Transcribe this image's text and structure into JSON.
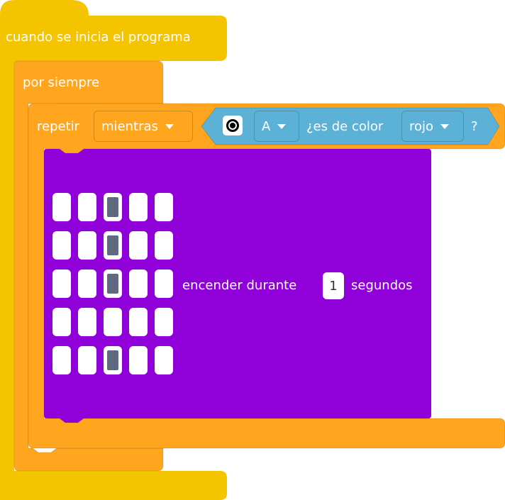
{
  "event_block": {
    "label": "cuando se inicia el programa"
  },
  "forever_block": {
    "label": "por siempre"
  },
  "repeat_block": {
    "label": "repetir",
    "mode_dropdown": "mientras"
  },
  "condition_block": {
    "port_icon": "color-sensor-icon",
    "port_dropdown": "A",
    "question": "¿es de color",
    "color_dropdown": "rojo",
    "question_end": "?"
  },
  "light_block": {
    "text_before": "encender durante",
    "duration": "1",
    "text_after": "segundos",
    "matrix": [
      [
        0,
        0,
        1,
        0,
        0
      ],
      [
        0,
        0,
        1,
        0,
        0
      ],
      [
        0,
        0,
        1,
        0,
        0
      ],
      [
        0,
        0,
        0,
        0,
        0
      ],
      [
        0,
        0,
        1,
        0,
        0
      ]
    ]
  },
  "colors": {
    "event": "#f5c400",
    "control": "#ffa51e",
    "sensor": "#5cb1d6",
    "light": "#9000d8"
  }
}
